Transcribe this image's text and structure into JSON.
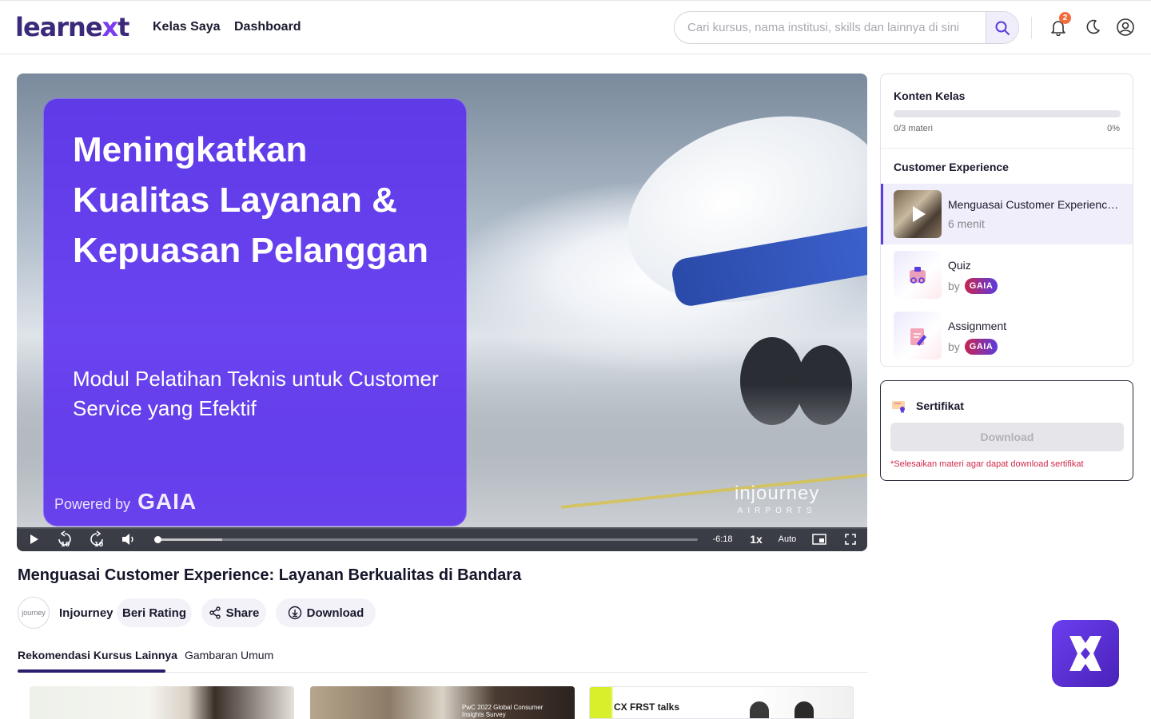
{
  "brand": {
    "logo_prefix": "learne",
    "logo_x": "x",
    "logo_suffix": "t"
  },
  "nav": {
    "kelas_saya": "Kelas Saya",
    "dashboard": "Dashboard"
  },
  "search": {
    "placeholder": "Cari kursus, nama institusi, skills dan lainnya di sini",
    "value": ""
  },
  "notifications": {
    "count": "2"
  },
  "video": {
    "overlay_title": "Meningkatkan Kualitas Layanan & Kepuasan Pelanggan",
    "overlay_subtitle": "Modul Pelatihan Teknis untuk Customer Service yang Efektif",
    "powered_by": "Powered by",
    "powered_brand": "GAIA",
    "brand_line1": "injourney",
    "brand_line2": "AIRPORTS",
    "time_remaining": "-6:18",
    "speed": "1x",
    "quality": "Auto",
    "progress": 0.0,
    "buffered": 0.12
  },
  "course": {
    "title": "Menguasai Customer Experience: Layanan Berkualitas di Bandara",
    "provider": "Injourney",
    "provider_avatar_text": "journey",
    "actions": {
      "rate": "Beri Rating",
      "share": "Share",
      "download": "Download"
    }
  },
  "tabs": {
    "recommendations": "Rekomendasi Kursus Lainnya",
    "overview": "Gambaran Umum"
  },
  "recommendations": [
    {
      "caption": ""
    },
    {
      "caption": "PwC 2022 Global Consumer Insights Survey"
    },
    {
      "caption": "CX FRST talks"
    }
  ],
  "sidebar": {
    "content_title": "Konten Kelas",
    "progress_label": "0/3 materi",
    "progress_percent": "0%",
    "progress": 0,
    "section_title": "Customer Experience",
    "lessons": [
      {
        "name": "Menguasai Customer Experience: Layanan Berkualitas di Bandara",
        "sub": "6 menit",
        "active": true
      },
      {
        "name": "Quiz",
        "sub": "by",
        "badge": "GAIA"
      },
      {
        "name": "Assignment",
        "sub": "by",
        "badge": "GAIA"
      }
    ]
  },
  "certificate": {
    "title": "Sertifikat",
    "button": "Download",
    "note": "*Selesaikan materi agar dapat download sertifikat"
  },
  "colors": {
    "primary": "#5b3ce0",
    "brand_dark": "#3b2a7a",
    "notif": "#f26b3a",
    "warning": "#d02a4a"
  }
}
